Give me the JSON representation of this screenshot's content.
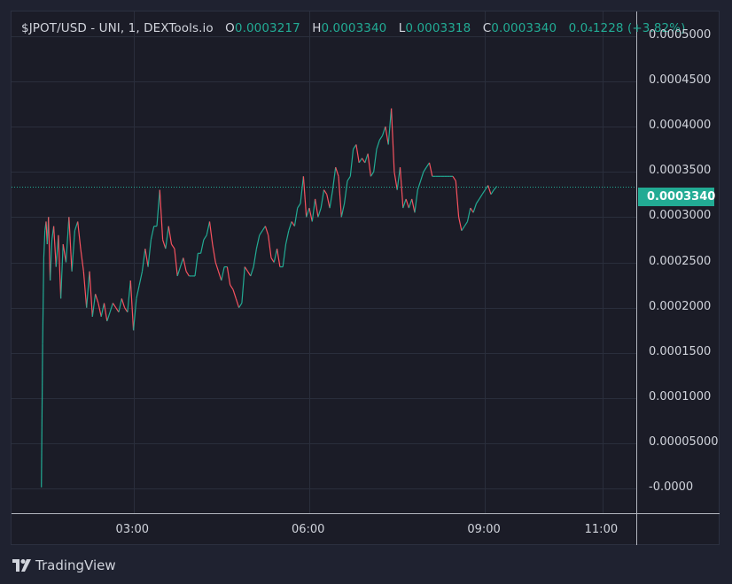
{
  "legend": {
    "symbol": "$JPOT/USD - UNI, 1, DEXTools.io",
    "o_label": "O",
    "o_value": "0.0003217",
    "h_label": "H",
    "h_value": "0.0003340",
    "l_label": "L",
    "l_value": "0.0003318",
    "c_label": "C",
    "c_value": "0.0003340",
    "change": "0.0₄1228 (+3.82%)"
  },
  "current_price": "0.0003340",
  "brand": {
    "name": "TradingView",
    "icon": "tradingview-logo-icon"
  },
  "colors": {
    "up": "#22ab94",
    "down": "#f7525f",
    "background": "#1b1c27",
    "grid": "#2a2e3c",
    "text": "#d1d4dc"
  },
  "chart_data": {
    "type": "line",
    "title": "$JPOT/USD - UNI, 1, DEXTools.io",
    "y_tick_labels": [
      "0.0005000",
      "0.0004500",
      "0.0004000",
      "0.0003500",
      "0.0003000",
      "0.0002500",
      "0.0002000",
      "0.0001500",
      "0.0001000",
      "0.00005000",
      "-0.0000"
    ],
    "y_ticks": [
      0.0005,
      0.00045,
      0.0004,
      0.00035,
      0.0003,
      0.00025,
      0.0002,
      0.00015,
      0.0001,
      5e-05,
      0
    ],
    "x_tick_labels": [
      "03:00",
      "06:00",
      "09:00",
      "11:00"
    ],
    "x_ticks_hours": [
      3,
      6,
      9,
      11
    ],
    "ylim": [
      -2.7e-05,
      0.000527
    ],
    "xlim_hours": [
      0.92,
      11.58
    ],
    "grid": true,
    "series": [
      {
        "x_hours": [
          1.43,
          1.45,
          1.47,
          1.49,
          1.51,
          1.53,
          1.55,
          1.58,
          1.61,
          1.64,
          1.68,
          1.72,
          1.76,
          1.8,
          1.85,
          1.9,
          1.95,
          2.0,
          2.05,
          2.1,
          2.15,
          2.2,
          2.25,
          2.3,
          2.35,
          2.4,
          2.45,
          2.5,
          2.55,
          2.6,
          2.65,
          2.7,
          2.75,
          2.8,
          2.85,
          2.9,
          2.95,
          3.0,
          3.05,
          3.1,
          3.15,
          3.2,
          3.25,
          3.3,
          3.35,
          3.4,
          3.45,
          3.5,
          3.55,
          3.6,
          3.65,
          3.7,
          3.75,
          3.8,
          3.85,
          3.9,
          3.95,
          4.0,
          4.05,
          4.1,
          4.15,
          4.2,
          4.25,
          4.3,
          4.35,
          4.4,
          4.45,
          4.5,
          4.55,
          4.6,
          4.65,
          4.7,
          4.75,
          4.8,
          4.85,
          4.9,
          4.95,
          5.0,
          5.05,
          5.1,
          5.15,
          5.2,
          5.25,
          5.3,
          5.35,
          5.4,
          5.45,
          5.5,
          5.55,
          5.6,
          5.65,
          5.7,
          5.75,
          5.8,
          5.85,
          5.9,
          5.95,
          6.0,
          6.05,
          6.1,
          6.15,
          6.2,
          6.25,
          6.3,
          6.35,
          6.4,
          6.45,
          6.5,
          6.55,
          6.6,
          6.65,
          6.7,
          6.75,
          6.8,
          6.85,
          6.9,
          6.95,
          7.0,
          7.05,
          7.1,
          7.15,
          7.2,
          7.25,
          7.3,
          7.35,
          7.4,
          7.45,
          7.5,
          7.55,
          7.6,
          7.65,
          7.7,
          7.75,
          7.8,
          7.85,
          7.9,
          7.95,
          8.0,
          8.05,
          8.1,
          8.15,
          8.2,
          8.25,
          8.3,
          8.35,
          8.4,
          8.45,
          8.5,
          8.55,
          8.6,
          8.65,
          8.7,
          8.75,
          8.8,
          8.85,
          8.9,
          8.95,
          9.0,
          9.05,
          9.1,
          9.15,
          9.2,
          9.25,
          9.3,
          9.35,
          9.4,
          9.45,
          9.5
        ],
        "y": [
          1.5e-06,
          0.00016,
          0.000255,
          0.000285,
          0.000295,
          0.00027,
          0.0003,
          0.00023,
          0.000275,
          0.00029,
          0.000245,
          0.00028,
          0.00021,
          0.00027,
          0.00025,
          0.0003,
          0.00024,
          0.000285,
          0.000295,
          0.000265,
          0.00024,
          0.0002,
          0.00024,
          0.00019,
          0.000215,
          0.000205,
          0.00019,
          0.000205,
          0.000185,
          0.000195,
          0.000205,
          0.0002,
          0.000195,
          0.00021,
          0.0002,
          0.000195,
          0.00023,
          0.000175,
          0.00021,
          0.000225,
          0.00024,
          0.000265,
          0.000245,
          0.000275,
          0.00029,
          0.00029,
          0.00033,
          0.000275,
          0.000265,
          0.00029,
          0.00027,
          0.000265,
          0.000235,
          0.000245,
          0.000255,
          0.00024,
          0.000235,
          0.000235,
          0.000235,
          0.00026,
          0.00026,
          0.000275,
          0.00028,
          0.000295,
          0.00027,
          0.00025,
          0.00024,
          0.00023,
          0.000245,
          0.000245,
          0.000225,
          0.00022,
          0.00021,
          0.0002,
          0.000205,
          0.000245,
          0.00024,
          0.000235,
          0.000245,
          0.000265,
          0.00028,
          0.000285,
          0.00029,
          0.00028,
          0.000255,
          0.00025,
          0.000265,
          0.000245,
          0.000245,
          0.00027,
          0.000285,
          0.000295,
          0.00029,
          0.00031,
          0.000315,
          0.000345,
          0.0003,
          0.00031,
          0.000295,
          0.00032,
          0.0003,
          0.00031,
          0.00033,
          0.000325,
          0.00031,
          0.00033,
          0.000355,
          0.000345,
          0.0003,
          0.000315,
          0.00034,
          0.000345,
          0.000375,
          0.00038,
          0.00036,
          0.000365,
          0.00036,
          0.00037,
          0.000345,
          0.00035,
          0.000375,
          0.000385,
          0.00039,
          0.0004,
          0.00038,
          0.00042,
          0.00035,
          0.00033,
          0.000355,
          0.00031,
          0.00032,
          0.00031,
          0.00032,
          0.000305,
          0.00033,
          0.00034,
          0.00035,
          0.000355,
          0.00036,
          0.000345,
          0.000345,
          0.000345,
          0.000345,
          0.000345,
          0.000345,
          0.000345,
          0.000345,
          0.00034,
          0.0003,
          0.000285,
          0.00029,
          0.000295,
          0.00031,
          0.000305,
          0.000315,
          0.00032,
          0.000325,
          0.00033,
          0.000335,
          0.000325,
          0.00033,
          0.000334
        ]
      }
    ]
  }
}
